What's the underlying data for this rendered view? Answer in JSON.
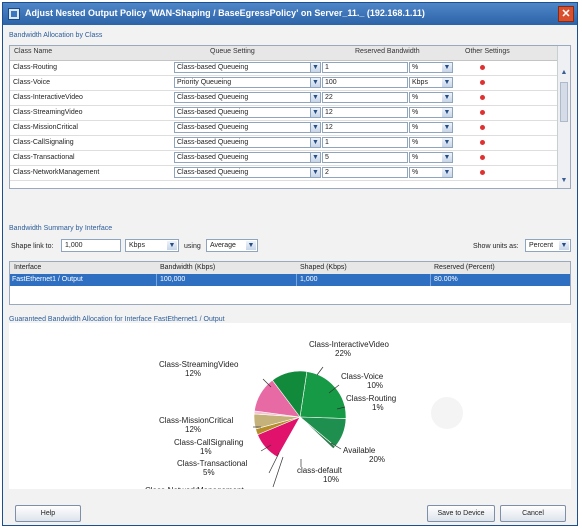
{
  "window": {
    "title": "Adjust Nested Output Policy 'WAN-Shaping / BaseEgressPolicy' on Server_11._ (192.168.1.11)"
  },
  "allocation": {
    "section_label": "Bandwidth Allocation by Class",
    "columns": {
      "class_name": "Class Name",
      "queue_setting": "Queue Setting",
      "reserved_bandwidth": "Reserved Bandwidth",
      "other_settings": "Other Settings"
    },
    "rows": [
      {
        "name": "Class-Routing",
        "queue": "Class-based Queueing",
        "bandwidth": "1",
        "unit": "%"
      },
      {
        "name": "Class-Voice",
        "queue": "Priority Queueing",
        "bandwidth": "100",
        "unit": "Kbps"
      },
      {
        "name": "Class-InteractiveVideo",
        "queue": "Class-based Queueing",
        "bandwidth": "22",
        "unit": "%"
      },
      {
        "name": "Class-StreamingVideo",
        "queue": "Class-based Queueing",
        "bandwidth": "12",
        "unit": "%"
      },
      {
        "name": "Class-MissionCritical",
        "queue": "Class-based Queueing",
        "bandwidth": "12",
        "unit": "%"
      },
      {
        "name": "Class-CallSignaling",
        "queue": "Class-based Queueing",
        "bandwidth": "1",
        "unit": "%"
      },
      {
        "name": "Class-Transactional",
        "queue": "Class-based Queueing",
        "bandwidth": "5",
        "unit": "%"
      },
      {
        "name": "Class-NetworkManagement",
        "queue": "Class-based Queueing",
        "bandwidth": "2",
        "unit": "%"
      }
    ]
  },
  "summary": {
    "section_label": "Bandwidth Summary by Interface",
    "shape_link_label": "Shape link to:",
    "shape_link_value": "1,000",
    "shape_unit": "Kbps",
    "using_label": "using",
    "using_value": "Average",
    "show_units_label": "Show units as:",
    "show_units_value": "Percent",
    "columns": {
      "interface": "Interface",
      "bandwidth": "Bandwidth (Kbps)",
      "shaped": "Shaped (Kbps)",
      "reserved": "Reserved (Percent)"
    },
    "row": {
      "interface": "FastEthernet1 / Output",
      "bandwidth": "100,000",
      "shaped": "1,000",
      "reserved": "80.00%"
    }
  },
  "chart": {
    "section_label": "Guaranteed Bandwidth Allocation for Interface FastEthernet1 / Output",
    "labels": {
      "interactive_video": [
        "Class-InteractiveVideo",
        "22%"
      ],
      "voice": [
        "Class-Voice",
        "10%"
      ],
      "routing": [
        "Class-Routing",
        "1%"
      ],
      "available": [
        "Available",
        "20%"
      ],
      "class_default": [
        "class-default",
        "10%"
      ],
      "network_management": [
        "Class-NetworkManagement"
      ],
      "transactional": [
        "Class-Transactional",
        "5%"
      ],
      "call_signaling": [
        "Class-CallSignaling",
        "1%"
      ],
      "mission_critical": [
        "Class-MissionCritical",
        "12%"
      ],
      "streaming_video": [
        "Class-StreamingVideo",
        "12%"
      ]
    }
  },
  "chart_data": {
    "type": "pie",
    "title": "Guaranteed Bandwidth Allocation for Interface FastEthernet1 / Output",
    "slices": [
      {
        "label": "Class-InteractiveVideo",
        "value": 22,
        "color": "#169a45"
      },
      {
        "label": "Class-Voice",
        "value": 10,
        "color": "#1e8f4e"
      },
      {
        "label": "Class-Routing",
        "value": 1,
        "color": "#2c7a4a"
      },
      {
        "label": "Available",
        "value": 20,
        "color": "#ffffff"
      },
      {
        "label": "class-default",
        "value": 10,
        "color": "#e0126c"
      },
      {
        "label": "Class-NetworkManagement",
        "value": 2,
        "color": "#b58e2a"
      },
      {
        "label": "Class-Transactional",
        "value": 5,
        "color": "#c4b27a"
      },
      {
        "label": "Class-CallSignaling",
        "value": 1,
        "color": "#f3c2d3"
      },
      {
        "label": "Class-MissionCritical",
        "value": 12,
        "color": "#e86aa4"
      },
      {
        "label": "Class-StreamingVideo",
        "value": 12,
        "color": "#128a3c"
      }
    ]
  },
  "buttons": {
    "help": "Help",
    "save": "Save to Device",
    "cancel": "Cancel"
  }
}
